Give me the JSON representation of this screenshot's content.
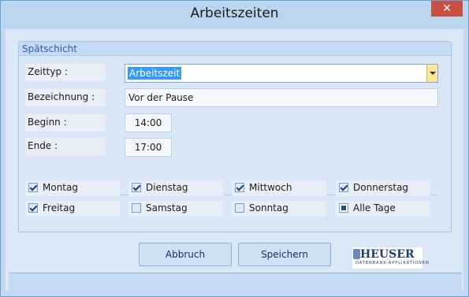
{
  "window": {
    "title": "Arbeitszeiten",
    "close_glyph": "✕"
  },
  "group": {
    "title": "Spätschicht",
    "labels": {
      "zeittyp": "Zeittyp :",
      "bezeichnung": "Bezeichnung :",
      "beginn": "Beginn :",
      "ende": "Ende :"
    },
    "values": {
      "zeittyp": "Arbeitszeit",
      "bezeichnung": "Vor der Pause",
      "beginn": "14:00",
      "ende": "17:00"
    }
  },
  "days": [
    {
      "label": "Montag",
      "checked": true
    },
    {
      "label": "Dienstag",
      "checked": true
    },
    {
      "label": "Mittwoch",
      "checked": true
    },
    {
      "label": "Donnerstag",
      "checked": true
    },
    {
      "label": "Freitag",
      "checked": true
    },
    {
      "label": "Samstag",
      "checked": false
    },
    {
      "label": "Sonntag",
      "checked": false
    },
    {
      "label": "Alle Tage",
      "checked": "indeterminate"
    }
  ],
  "buttons": {
    "cancel": "Abbruch",
    "save": "Speichern"
  },
  "logo": {
    "name": "HEUSER",
    "tagline": "DATENBANK-APPLIKATIONEN"
  },
  "colors": {
    "titlebar": "#bcd5ef",
    "close": "#c74f44",
    "accent": "#3399ff",
    "group_title": "#2a5ea8"
  }
}
